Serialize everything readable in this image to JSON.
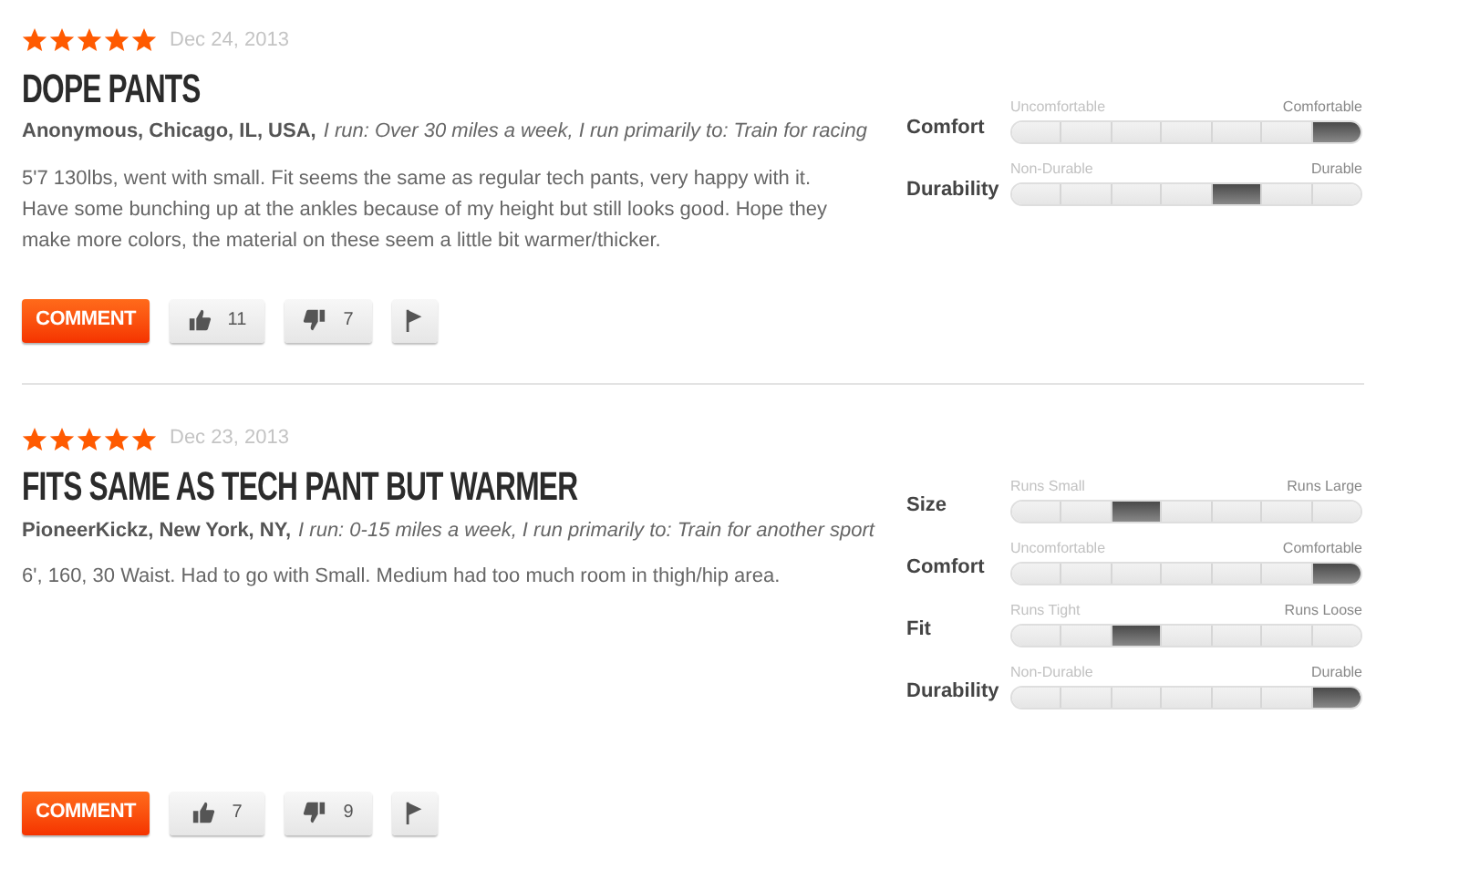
{
  "reviews": [
    {
      "stars": 5,
      "date": "Dec 24, 2013",
      "title": "DOPE PANTS",
      "author": "Anonymous, Chicago, IL, USA,",
      "runner_info": "I run: Over 30 miles a week, I run primarily to: Train for racing",
      "body": "5'7 130lbs, went with small. Fit seems the same as regular tech pants, very happy with it. Have some bunching up at the ankles because of my height but still looks good. Hope they make more colors, the material on these seem a little bit warmer/thicker.",
      "comment_label": "COMMENT",
      "helpful_count": "11",
      "unhelpful_count": "7",
      "ratings": [
        {
          "label": "Comfort",
          "low": "Uncomfortable",
          "high": "Comfortable",
          "segments": [
            {
              "selected": false
            },
            {
              "selected": false
            },
            {
              "selected": false
            },
            {
              "selected": false
            },
            {
              "selected": false
            },
            {
              "selected": false
            },
            {
              "selected": true
            }
          ]
        },
        {
          "label": "Durability",
          "low": "Non-Durable",
          "high": "Durable",
          "segments": [
            {
              "selected": false
            },
            {
              "selected": false
            },
            {
              "selected": false
            },
            {
              "selected": false
            },
            {
              "selected": true
            },
            {
              "selected": false
            },
            {
              "selected": false
            }
          ]
        }
      ]
    },
    {
      "stars": 5,
      "date": "Dec 23, 2013",
      "title": "FITS SAME AS TECH PANT BUT WARMER",
      "author": "PioneerKickz, New York, NY,",
      "runner_info": "I run: 0-15 miles a week, I run primarily to: Train for another sport",
      "body": "6', 160, 30 Waist. Had to go with Small. Medium had too much room in thigh/hip area.",
      "comment_label": "COMMENT",
      "helpful_count": "7",
      "unhelpful_count": "9",
      "ratings": [
        {
          "label": "Size",
          "low": "Runs Small",
          "high": "Runs Large",
          "segments": [
            {
              "selected": false
            },
            {
              "selected": false
            },
            {
              "selected": true
            },
            {
              "selected": false
            },
            {
              "selected": false
            },
            {
              "selected": false
            },
            {
              "selected": false
            }
          ]
        },
        {
          "label": "Comfort",
          "low": "Uncomfortable",
          "high": "Comfortable",
          "segments": [
            {
              "selected": false
            },
            {
              "selected": false
            },
            {
              "selected": false
            },
            {
              "selected": false
            },
            {
              "selected": false
            },
            {
              "selected": false
            },
            {
              "selected": true
            }
          ]
        },
        {
          "label": "Fit",
          "low": "Runs Tight",
          "high": "Runs Loose",
          "segments": [
            {
              "selected": false
            },
            {
              "selected": false
            },
            {
              "selected": true
            },
            {
              "selected": false
            },
            {
              "selected": false
            },
            {
              "selected": false
            },
            {
              "selected": false
            }
          ]
        },
        {
          "label": "Durability",
          "low": "Non-Durable",
          "high": "Durable",
          "segments": [
            {
              "selected": false
            },
            {
              "selected": false
            },
            {
              "selected": false
            },
            {
              "selected": false
            },
            {
              "selected": false
            },
            {
              "selected": false
            },
            {
              "selected": true
            }
          ]
        }
      ]
    }
  ]
}
